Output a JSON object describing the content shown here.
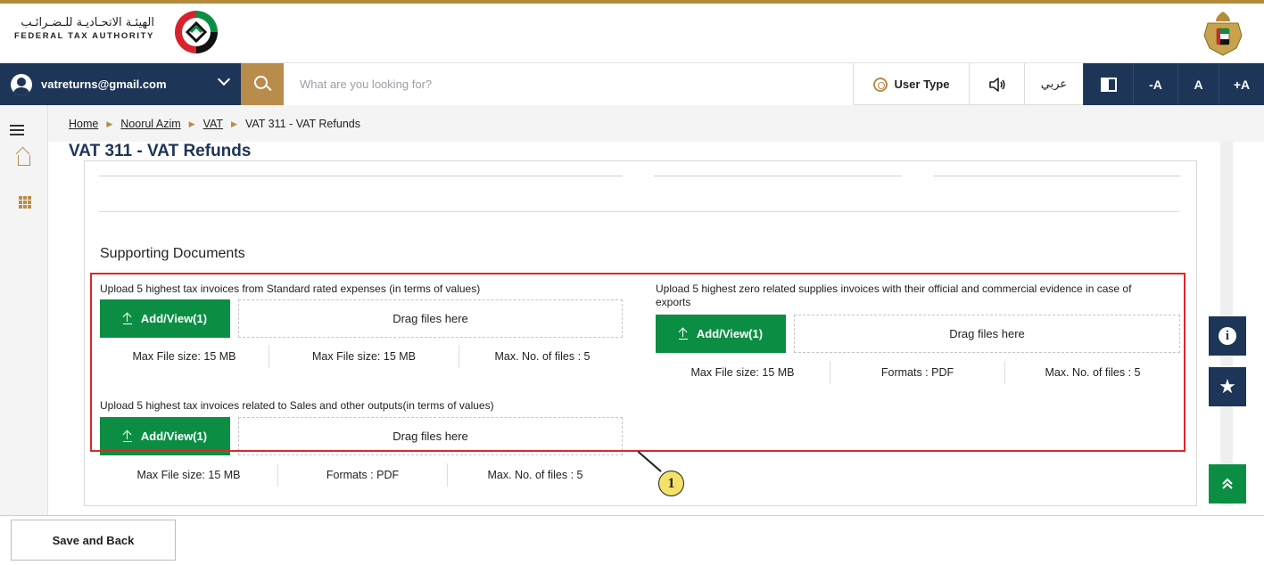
{
  "header": {
    "org_name_ar": "الهيئـة الاتحـاديـة للـضـرائـب",
    "org_name_en": "FEDERAL TAX AUTHORITY",
    "logo_icon": "fta-logo-icon",
    "emblem_icon": "uae-emblem-icon"
  },
  "nav": {
    "user_email": "vatreturns@gmail.com",
    "search_placeholder": "What are you looking for?",
    "user_type_label": "User Type",
    "language_label": "عربي",
    "font_decrease": "-A",
    "font_normal": "A",
    "font_increase": "+A"
  },
  "breadcrumb": [
    {
      "label": "Home"
    },
    {
      "label": "Noorul Azim"
    },
    {
      "label": "VAT"
    },
    {
      "label": "VAT 311 - VAT Refunds"
    }
  ],
  "page": {
    "title": "VAT 311 - VAT Refunds",
    "section_title": "Supporting Documents"
  },
  "uploads": [
    {
      "label": "Upload 5 highest tax invoices from Standard rated expenses (in terms of values)",
      "button": "Add/View(1)",
      "drop": "Drag files here",
      "info": [
        "Max File size: 15 MB",
        "Max File size: 15 MB",
        "Max. No. of files : 5"
      ]
    },
    {
      "label": "Upload 5 highest zero related supplies invoices with their official and commercial evidence in case of exports",
      "button": "Add/View(1)",
      "drop": "Drag files here",
      "info": [
        "Max File size: 15 MB",
        "Formats : PDF",
        "Max. No. of files : 5"
      ]
    },
    {
      "label": "Upload 5 highest tax invoices related to Sales and other outputs(in terms of values)",
      "button": "Add/View(1)",
      "drop": "Drag files here",
      "info": [
        "Max File size: 15 MB",
        "Formats : PDF",
        "Max. No. of files : 5"
      ]
    }
  ],
  "annotation": {
    "callout_number": "1",
    "highlight_color": "#e0262b"
  },
  "footer": {
    "save_back_label": "Save and Back"
  },
  "colors": {
    "navy": "#1d3557",
    "gold": "#b88c4a",
    "green": "#0b8e44"
  }
}
